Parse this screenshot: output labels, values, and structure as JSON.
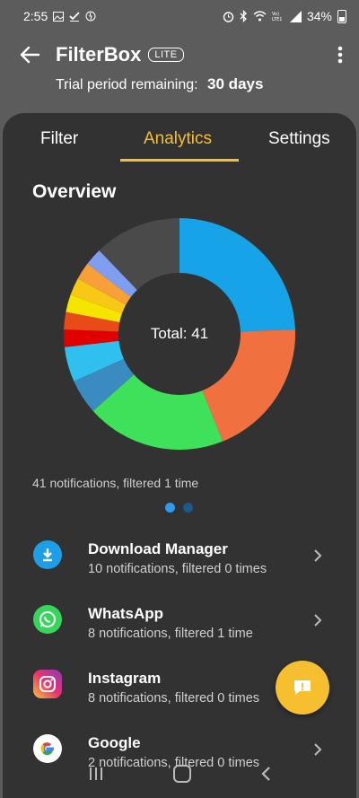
{
  "status_bar": {
    "time": "2:55",
    "battery": "34%",
    "icons": [
      "image-icon",
      "check-icon",
      "sync-icon",
      "alarm-icon",
      "bluetooth-icon",
      "wifi-icon",
      "volte-icon",
      "signal-icon",
      "battery-icon"
    ]
  },
  "app_bar": {
    "back_icon": "arrow-back-icon",
    "title": "FilterBox",
    "badge": "LITE",
    "menu_icon": "more-vert-icon"
  },
  "trial": {
    "label": "Trial period remaining:",
    "value": "30 days"
  },
  "tabs": [
    {
      "label": "Filter",
      "active": false
    },
    {
      "label": "Analytics",
      "active": true
    },
    {
      "label": "Settings",
      "active": false
    }
  ],
  "overview": {
    "title": "Overview",
    "total_label": "Total: 41",
    "summary": "41 notifications, filtered 1 time"
  },
  "chart_data": {
    "type": "pie",
    "total": 41,
    "slices": [
      {
        "name": "Download Manager",
        "value": 10,
        "color": "#17a3e8"
      },
      {
        "name": "WhatsApp",
        "value": 8,
        "color": "#f07040"
      },
      {
        "name": "Instagram",
        "value": 8,
        "color": "#3fe05a"
      },
      {
        "value": 2,
        "color": "#3a8cc0"
      },
      {
        "value": 2,
        "color": "#2fc0f0"
      },
      {
        "value": 1,
        "color": "#e00000"
      },
      {
        "value": 1,
        "color": "#e84a18"
      },
      {
        "value": 1,
        "color": "#f4e400"
      },
      {
        "value": 1,
        "color": "#f7c815"
      },
      {
        "value": 1,
        "color": "#f7a03a"
      },
      {
        "value": 1,
        "color": "#7f9ef0"
      },
      {
        "value": 5,
        "color": "#4a4a4a"
      }
    ]
  },
  "pager": {
    "pages": 2,
    "active": 0
  },
  "apps": [
    {
      "name": "Download Manager",
      "detail": "10 notifications, filtered 0 times",
      "icon": "download-icon"
    },
    {
      "name": "WhatsApp",
      "detail": "8 notifications, filtered 1 time",
      "icon": "whatsapp-icon"
    },
    {
      "name": "Instagram",
      "detail": "8 notifications, filtered 0 times",
      "icon": "instagram-icon"
    },
    {
      "name": "Google",
      "detail": "2 notifications, filtered 0 times",
      "icon": "google-icon"
    }
  ],
  "colors": {
    "accent": "#f5bf30",
    "sheet": "#323232",
    "header": "#5c5c5c"
  }
}
